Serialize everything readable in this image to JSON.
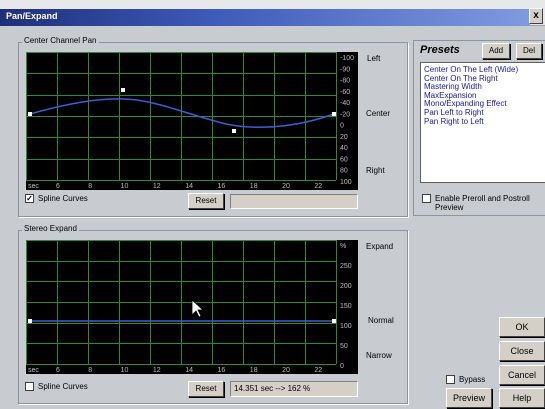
{
  "window": {
    "title": "Pan/Expand",
    "close_label": "x"
  },
  "pan": {
    "group_label": "Center Channel Pan",
    "right_labels": [
      "Left",
      "Center",
      "Right"
    ],
    "y_ticks": [
      "-100",
      "-90",
      "-80",
      "-60",
      "-40",
      "-20",
      "0",
      "20",
      "40",
      "60",
      "80",
      "100"
    ],
    "x_ticks": [
      "sec",
      "6",
      "8",
      "10",
      "12",
      "14",
      "16",
      "18",
      "20",
      "22"
    ],
    "spline_label": "Spline Curves",
    "spline_checked": "✓",
    "reset_label": "Reset",
    "status": ""
  },
  "expand": {
    "group_label": "Stereo Expand",
    "right_labels": [
      "Expand",
      "Normal",
      "Narrow"
    ],
    "y_ticks": [
      "%",
      "250",
      "200",
      "150",
      "100",
      "50",
      "0"
    ],
    "x_ticks": [
      "sec",
      "6",
      "8",
      "10",
      "12",
      "14",
      "16",
      "18",
      "20",
      "22"
    ],
    "spline_label": "Spline Curves",
    "spline_checked": "",
    "reset_label": "Reset",
    "status": "14.351 sec --> 162 %"
  },
  "presets": {
    "title": "Presets",
    "add_label": "Add",
    "del_label": "Del",
    "items": [
      "Center On The Left (Wide)",
      "Center On The Right",
      "Mastering Width",
      "MaxExpansion",
      "Mono/Expanding Effect",
      "Pan Left to Right",
      "Pan Right to Left"
    ],
    "preroll_label_1": "Enable Preroll and Postroll",
    "preroll_label_2": "Preview"
  },
  "buttons": {
    "ok": "OK",
    "close": "Close",
    "cancel": "Cancel",
    "bypass": "Bypass",
    "preview": "Preview",
    "help": "Help"
  },
  "colors": {
    "grid": "#2f8a2f",
    "curve": "#3a5fd0",
    "point": "#ffffff",
    "background": "#000000"
  }
}
